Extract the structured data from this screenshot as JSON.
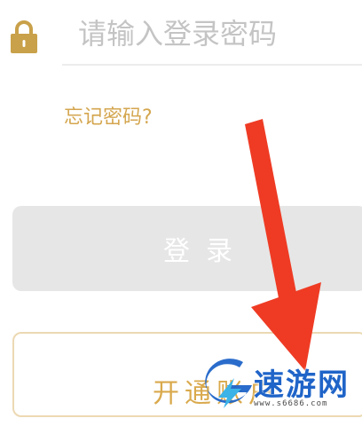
{
  "login_form": {
    "password_placeholder": "请输入登录密码",
    "forgot_password_label": "忘记密码?",
    "login_button_label": "登录",
    "open_account_button_label": "开通账户"
  },
  "icons": {
    "lock": "lock-icon"
  },
  "colors": {
    "accent_gold": "#d4a64f",
    "disabled_button": "#e6e6e6",
    "annotation_arrow": "#ef3b24",
    "watermark_blue": "#1f64c8"
  },
  "watermark": {
    "logo_text": "速游网",
    "sub_text": "www.s6686.com"
  }
}
